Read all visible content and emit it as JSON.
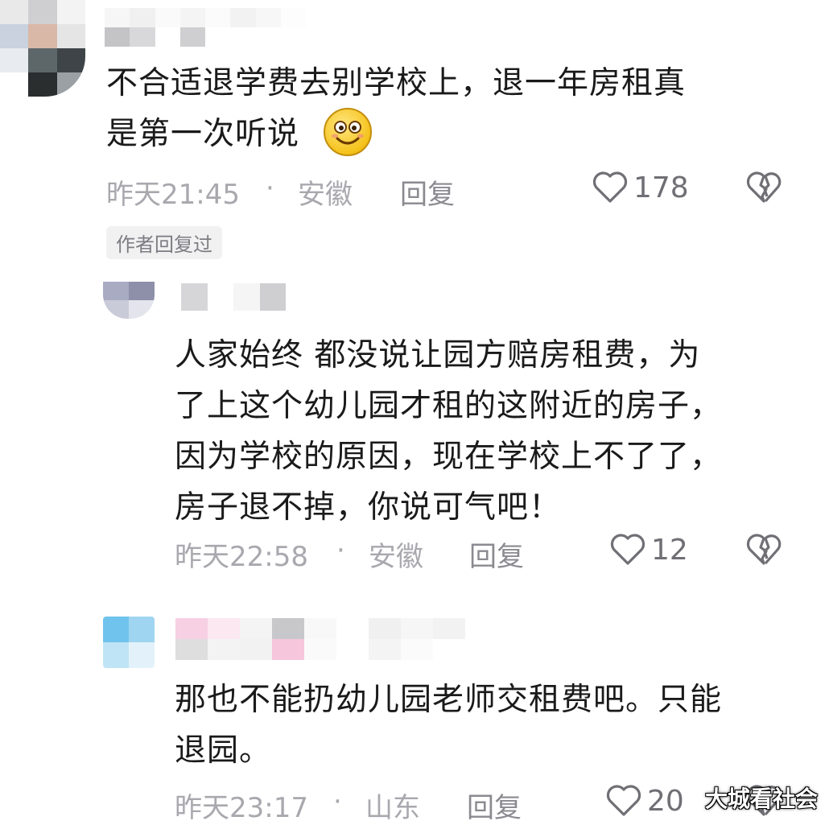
{
  "comments": [
    {
      "text": "不合适退学费去别学校上，退一年房租真\n是第一次听说",
      "emoji": "smile-face",
      "time": "昨天21:45",
      "location": "安徽",
      "separator": "·",
      "reply_label": "回复",
      "likes": "178",
      "badge": "作者回复过"
    },
    {
      "text": "人家始终 都没说让园方赔房租费，为\n了上这个幼儿园才租的这附近的房子，\n因为学校的原因，现在学校上不了了，\n房子退不掉，你说可气吧！",
      "time": "昨天22:58",
      "location": "安徽",
      "separator": "·",
      "reply_label": "回复",
      "likes": "12"
    },
    {
      "text": "那也不能扔幼儿园老师交租费吧。只能\n退园。",
      "time": "昨天23:17",
      "location": "山东",
      "separator": "·",
      "reply_label": "回复",
      "likes": "20"
    }
  ],
  "watermark": "大城看社会",
  "colors": {
    "text": "#1a1a1a",
    "meta": "#a8a8ae",
    "reply": "#8a8a90"
  }
}
